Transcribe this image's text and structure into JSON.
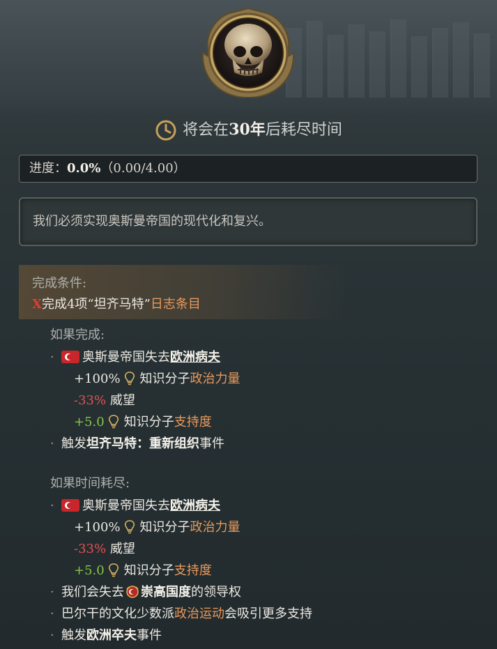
{
  "timer": {
    "prefix": "将会在",
    "years": "30年",
    "suffix": "后耗尽时间"
  },
  "progress": {
    "label": "进度：",
    "percent": "0.0%",
    "detail": "（0.00/4.00）",
    "fraction": 0.0
  },
  "description": "我们必须实现奥斯曼帝国的现代化和复兴。",
  "conditions": {
    "header": "完成条件:",
    "mark": "X",
    "text_a": "完成4项“坦齐马特”",
    "text_b": "日志条目"
  },
  "on_complete": {
    "header": "如果完成:",
    "lose_a": "奥斯曼帝国失去",
    "lose_b": "欧洲病夫",
    "eff1_a": "+100%",
    "eff1_b": "知识分子",
    "eff1_c": "政治力量",
    "eff2_a": "-33%",
    "eff2_b": "威望",
    "eff3_a": "+5.0",
    "eff3_b": "知识分子",
    "eff3_c": "支持度",
    "trigger_a": "触发",
    "trigger_b": "坦齐马特：重新组织",
    "trigger_c": "事件"
  },
  "on_timeout": {
    "header": "如果时间耗尽:",
    "lose_a": "奥斯曼帝国失去",
    "lose_b": "欧洲病夫",
    "eff1_a": "+100%",
    "eff1_b": "知识分子",
    "eff1_c": "政治力量",
    "eff2_a": "-33%",
    "eff2_b": "威望",
    "eff3_a": "+5.0",
    "eff3_b": "知识分子",
    "eff3_c": "支持度",
    "lead_a": "我们会失去",
    "lead_b": "崇高国度",
    "lead_c": "的领导权",
    "balkan_a": "巴尔干的文化少数派",
    "balkan_b": "政治运动",
    "balkan_c": "会吸引更多支持",
    "trigger_a": "触发",
    "trigger_b": "欧洲卒夫",
    "trigger_c": "事件"
  },
  "icons": {
    "skull": "skull-icon",
    "clock": "clock-icon",
    "flag": "turkey-flag-icon",
    "bulb": "lightbulb-icon",
    "emblem": "ottoman-emblem-icon"
  },
  "colors": {
    "orange": "#e89a5c",
    "red": "#e35252",
    "green": "#86c74a"
  }
}
